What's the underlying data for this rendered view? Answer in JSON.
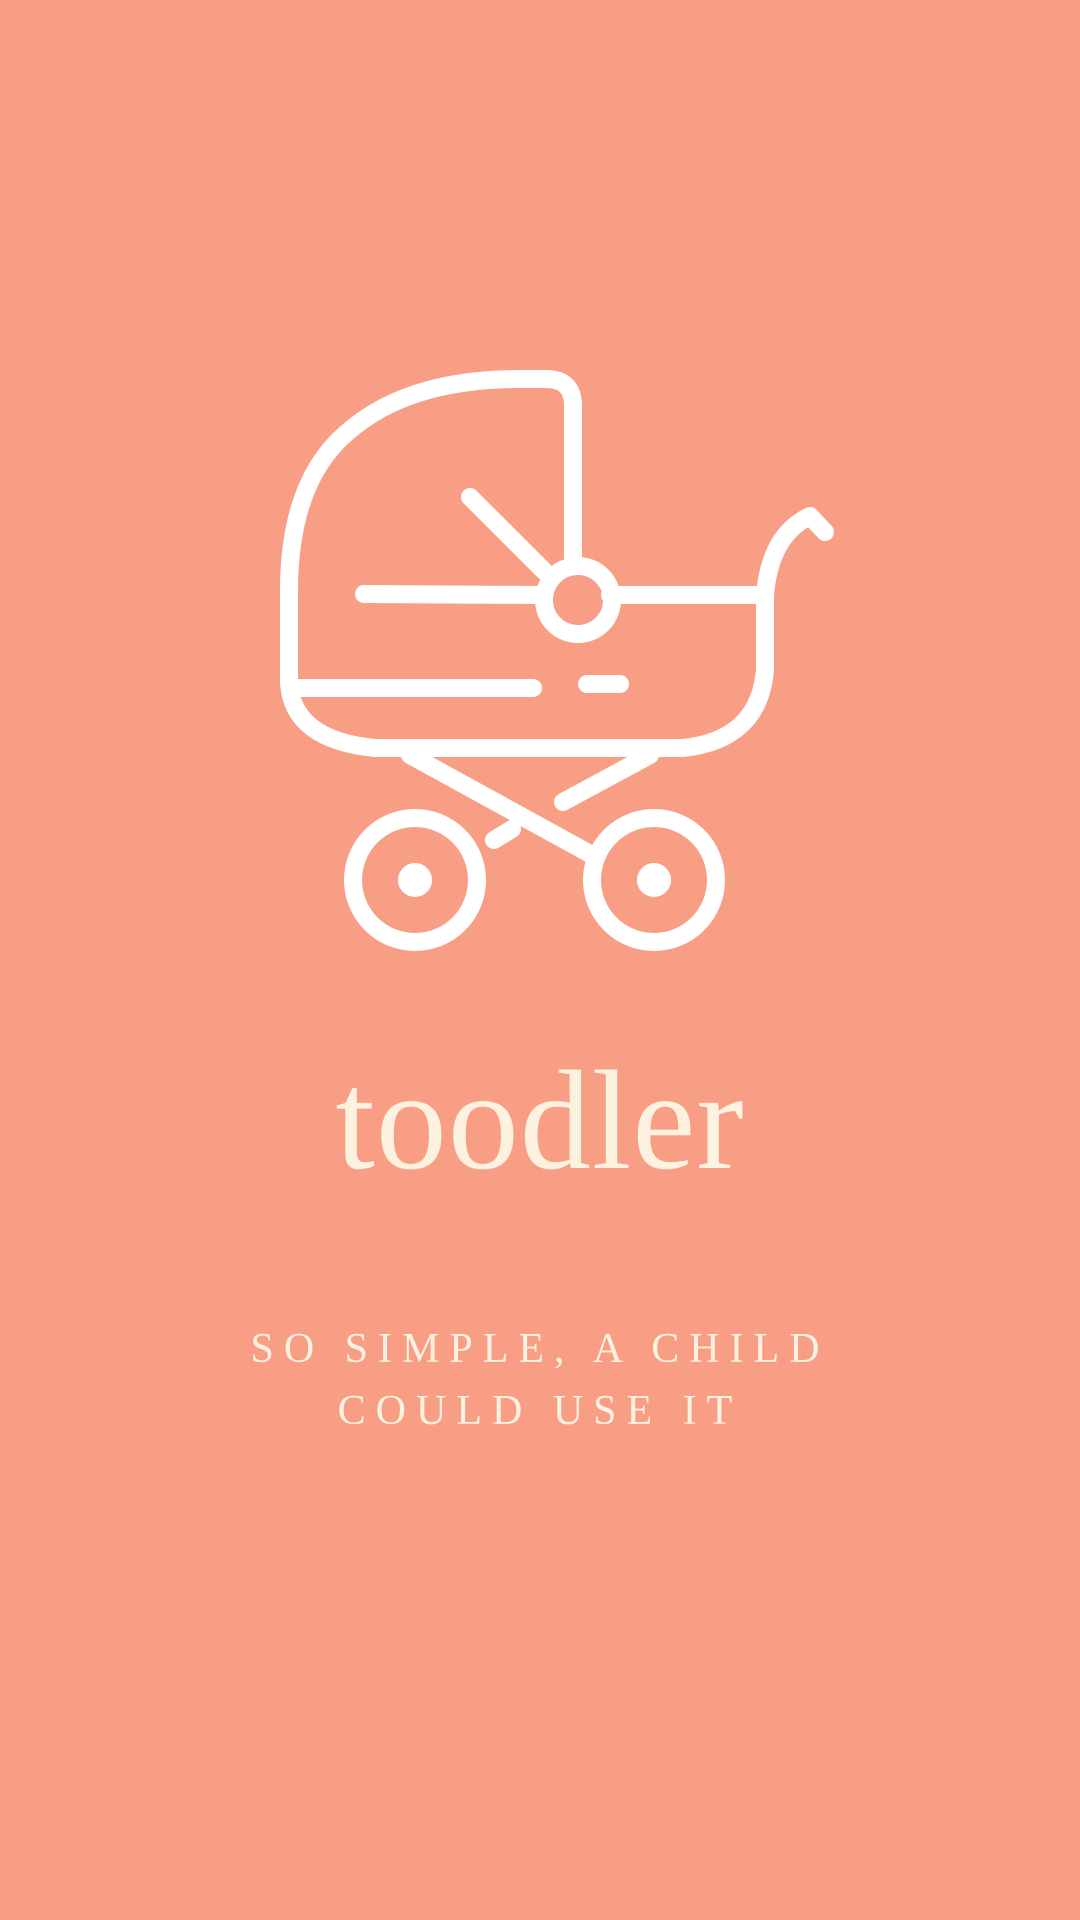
{
  "splash": {
    "logo_icon": "baby-stroller-icon",
    "app_name": "toodler",
    "tagline_line1": "SO SIMPLE, A CHILD",
    "tagline_line2": "COULD USE IT"
  },
  "colors": {
    "background": "#F89E85",
    "icon": "#FFFFFF",
    "text": "#FDF1E0"
  }
}
